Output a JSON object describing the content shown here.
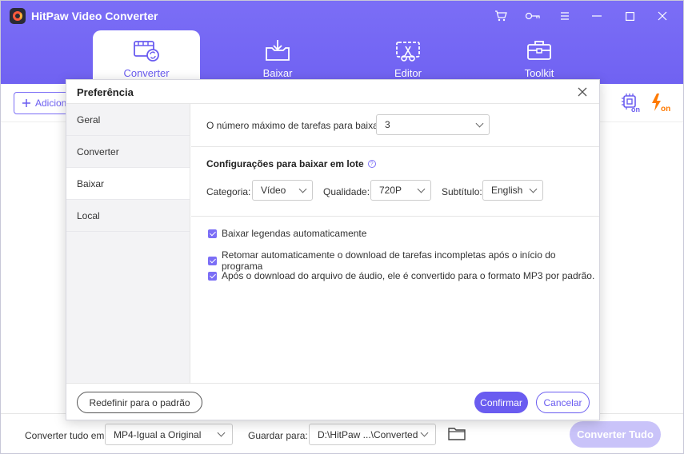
{
  "app": {
    "title": "HitPaw Video Converter"
  },
  "nav": {
    "tabs": [
      {
        "label": "Converter",
        "icon": "converter-icon",
        "active": true
      },
      {
        "label": "Baixar",
        "icon": "download-icon",
        "active": false
      },
      {
        "label": "Editor",
        "icon": "editor-icon",
        "active": false
      },
      {
        "label": "Toolkit",
        "icon": "toolkit-icon",
        "active": false
      }
    ]
  },
  "toolbar": {
    "add_label": "Adiciona",
    "hw_accel_label": "on",
    "speed_label": "on"
  },
  "modal": {
    "title": "Preferência",
    "sidebar": [
      {
        "label": "Geral"
      },
      {
        "label": "Converter"
      },
      {
        "label": "Baixar"
      },
      {
        "label": "Local"
      }
    ],
    "max_tasks": {
      "label": "O número máximo de tarefas para baixar:",
      "value": "3"
    },
    "batch": {
      "title": "Configurações para baixar em lote",
      "category_label": "Categoria:",
      "category_value": "Vídeo",
      "quality_label": "Qualidade:",
      "quality_value": "720P",
      "subtitle_label": "Subtítulo:",
      "subtitle_value": "English"
    },
    "options": [
      {
        "label": "Baixar legendas automaticamente",
        "checked": true
      },
      {
        "label": "Retomar automaticamente o download de tarefas incompletas após o início do programa",
        "checked": true
      },
      {
        "label": "Após o download do arquivo de áudio, ele é convertido para o formato MP3 por padrão.",
        "checked": true
      }
    ],
    "reset_label": "Redefinir para o padrão",
    "confirm_label": "Confirmar",
    "cancel_label": "Cancelar"
  },
  "bottom": {
    "convert_all_label": "Converter tudo em:",
    "convert_all_value": "MP4-Igual a Original",
    "save_to_label": "Guardar para:",
    "save_to_value": "D:\\HitPaw ...\\Converted",
    "convert_all_button": "Converter Tudo"
  },
  "colors": {
    "accent": "#6a5cf0",
    "header": "#7566f3",
    "speed": "#ff7a00"
  }
}
